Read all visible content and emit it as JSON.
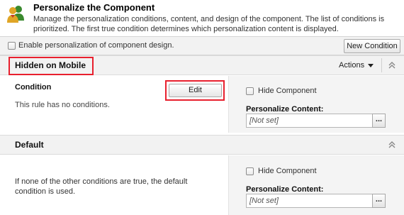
{
  "header": {
    "icon": "users-icon",
    "title": "Personalize the Component",
    "description": "Manage the personalization conditions, content, and design of the component. The list of conditions is prioritized. The first true condition determines which personalization content is displayed."
  },
  "toolbar": {
    "enable_design_label": "Enable personalization of component design.",
    "enable_design_checked": false,
    "new_condition_label": "New Condition"
  },
  "rules": [
    {
      "title": "Hidden on Mobile",
      "actions_label": "Actions",
      "condition_heading": "Condition",
      "edit_label": "Edit",
      "condition_text": "This rule has no conditions.",
      "hide_component_label": "Hide Component",
      "hide_component_checked": false,
      "personalize_label": "Personalize Content:",
      "personalize_value": "[Not set]",
      "browse_label": "..."
    },
    {
      "title": "Default",
      "description": "If none of the other conditions are true, the default condition is used.",
      "hide_component_label": "Hide Component",
      "hide_component_checked": false,
      "personalize_label": "Personalize Content:",
      "personalize_value": "[Not set]",
      "browse_label": "..."
    }
  ],
  "colors": {
    "highlight": "#e8202e",
    "section_bg": "#f2f2f2",
    "right_panel_bg": "#f4f4f4"
  }
}
